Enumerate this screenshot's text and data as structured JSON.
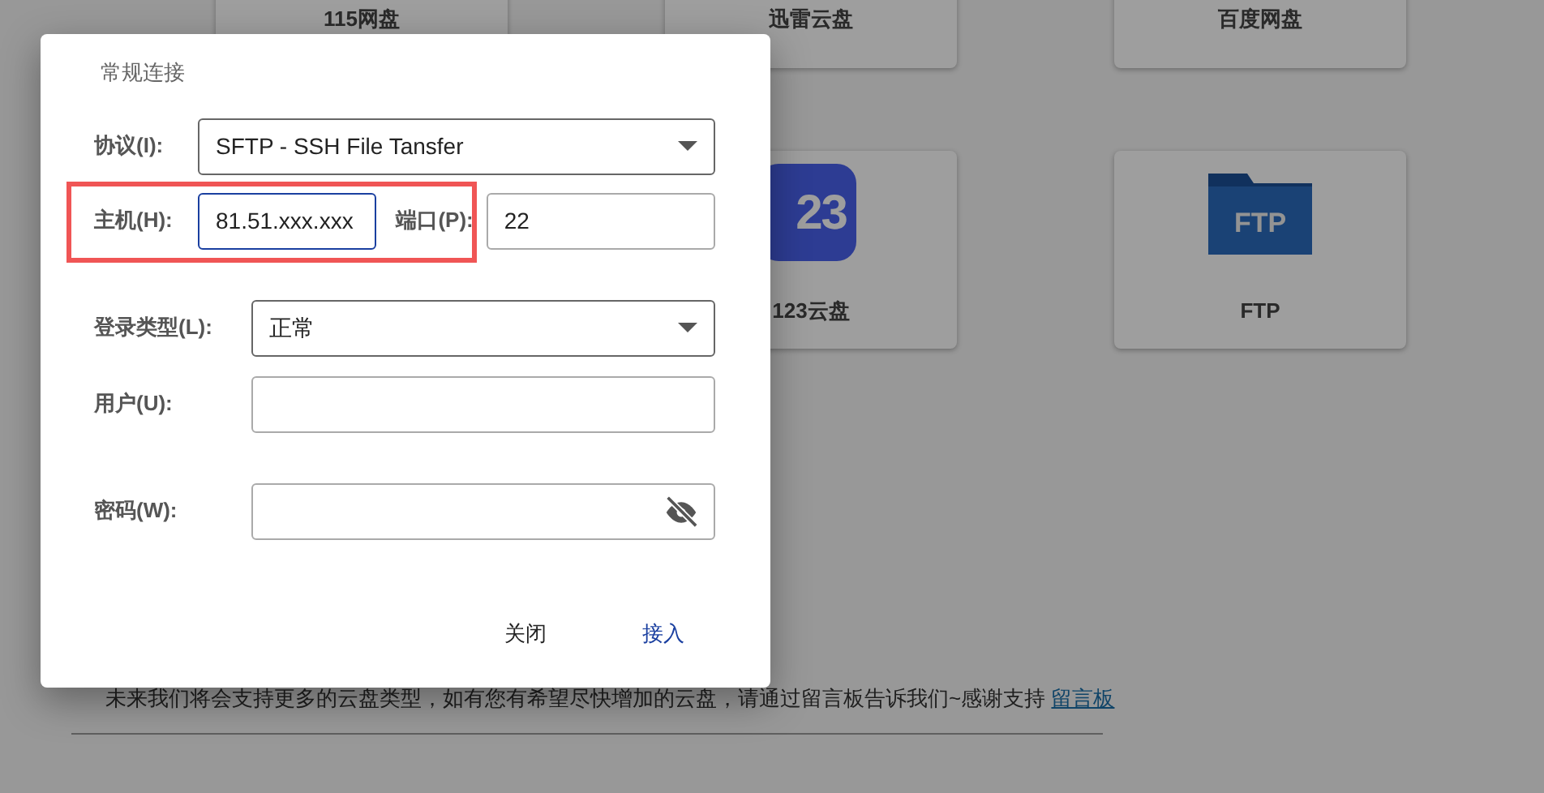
{
  "background": {
    "cards": [
      {
        "label": "115网盘",
        "kind": "plain"
      },
      {
        "label": "迅雷云盘",
        "kind": "plain"
      },
      {
        "label": "百度网盘",
        "kind": "plain"
      },
      {
        "label": "123云盘",
        "kind": "app",
        "icon_text": "23"
      },
      {
        "label": "FTP",
        "kind": "folder",
        "icon_text": "FTP"
      }
    ],
    "notice": {
      "text": "未来我们将会支持更多的云盘类型，如有您有希望尽快增加的云盘，请通过留言板告诉我们~感谢支持",
      "link": "留言板"
    }
  },
  "dialog": {
    "title": "常规连接",
    "fields": [
      {
        "kind": "select",
        "label": "协议(I):",
        "value": "SFTP - SSH File Tansfer"
      },
      {
        "kind": "host",
        "label": "主机(H):",
        "value": "81.51.xxx.xxx",
        "focused": true,
        "highlighted": true,
        "port_label": "端口(P):",
        "port_value": "22"
      },
      {
        "kind": "select",
        "label": "登录类型(L):",
        "value": "正常"
      },
      {
        "kind": "text",
        "label": "用户(U):"
      },
      {
        "kind": "password",
        "label": "密码(W):"
      }
    ],
    "buttons": [
      {
        "label": "关闭",
        "primary": false
      },
      {
        "label": "接入",
        "primary": true
      }
    ]
  }
}
